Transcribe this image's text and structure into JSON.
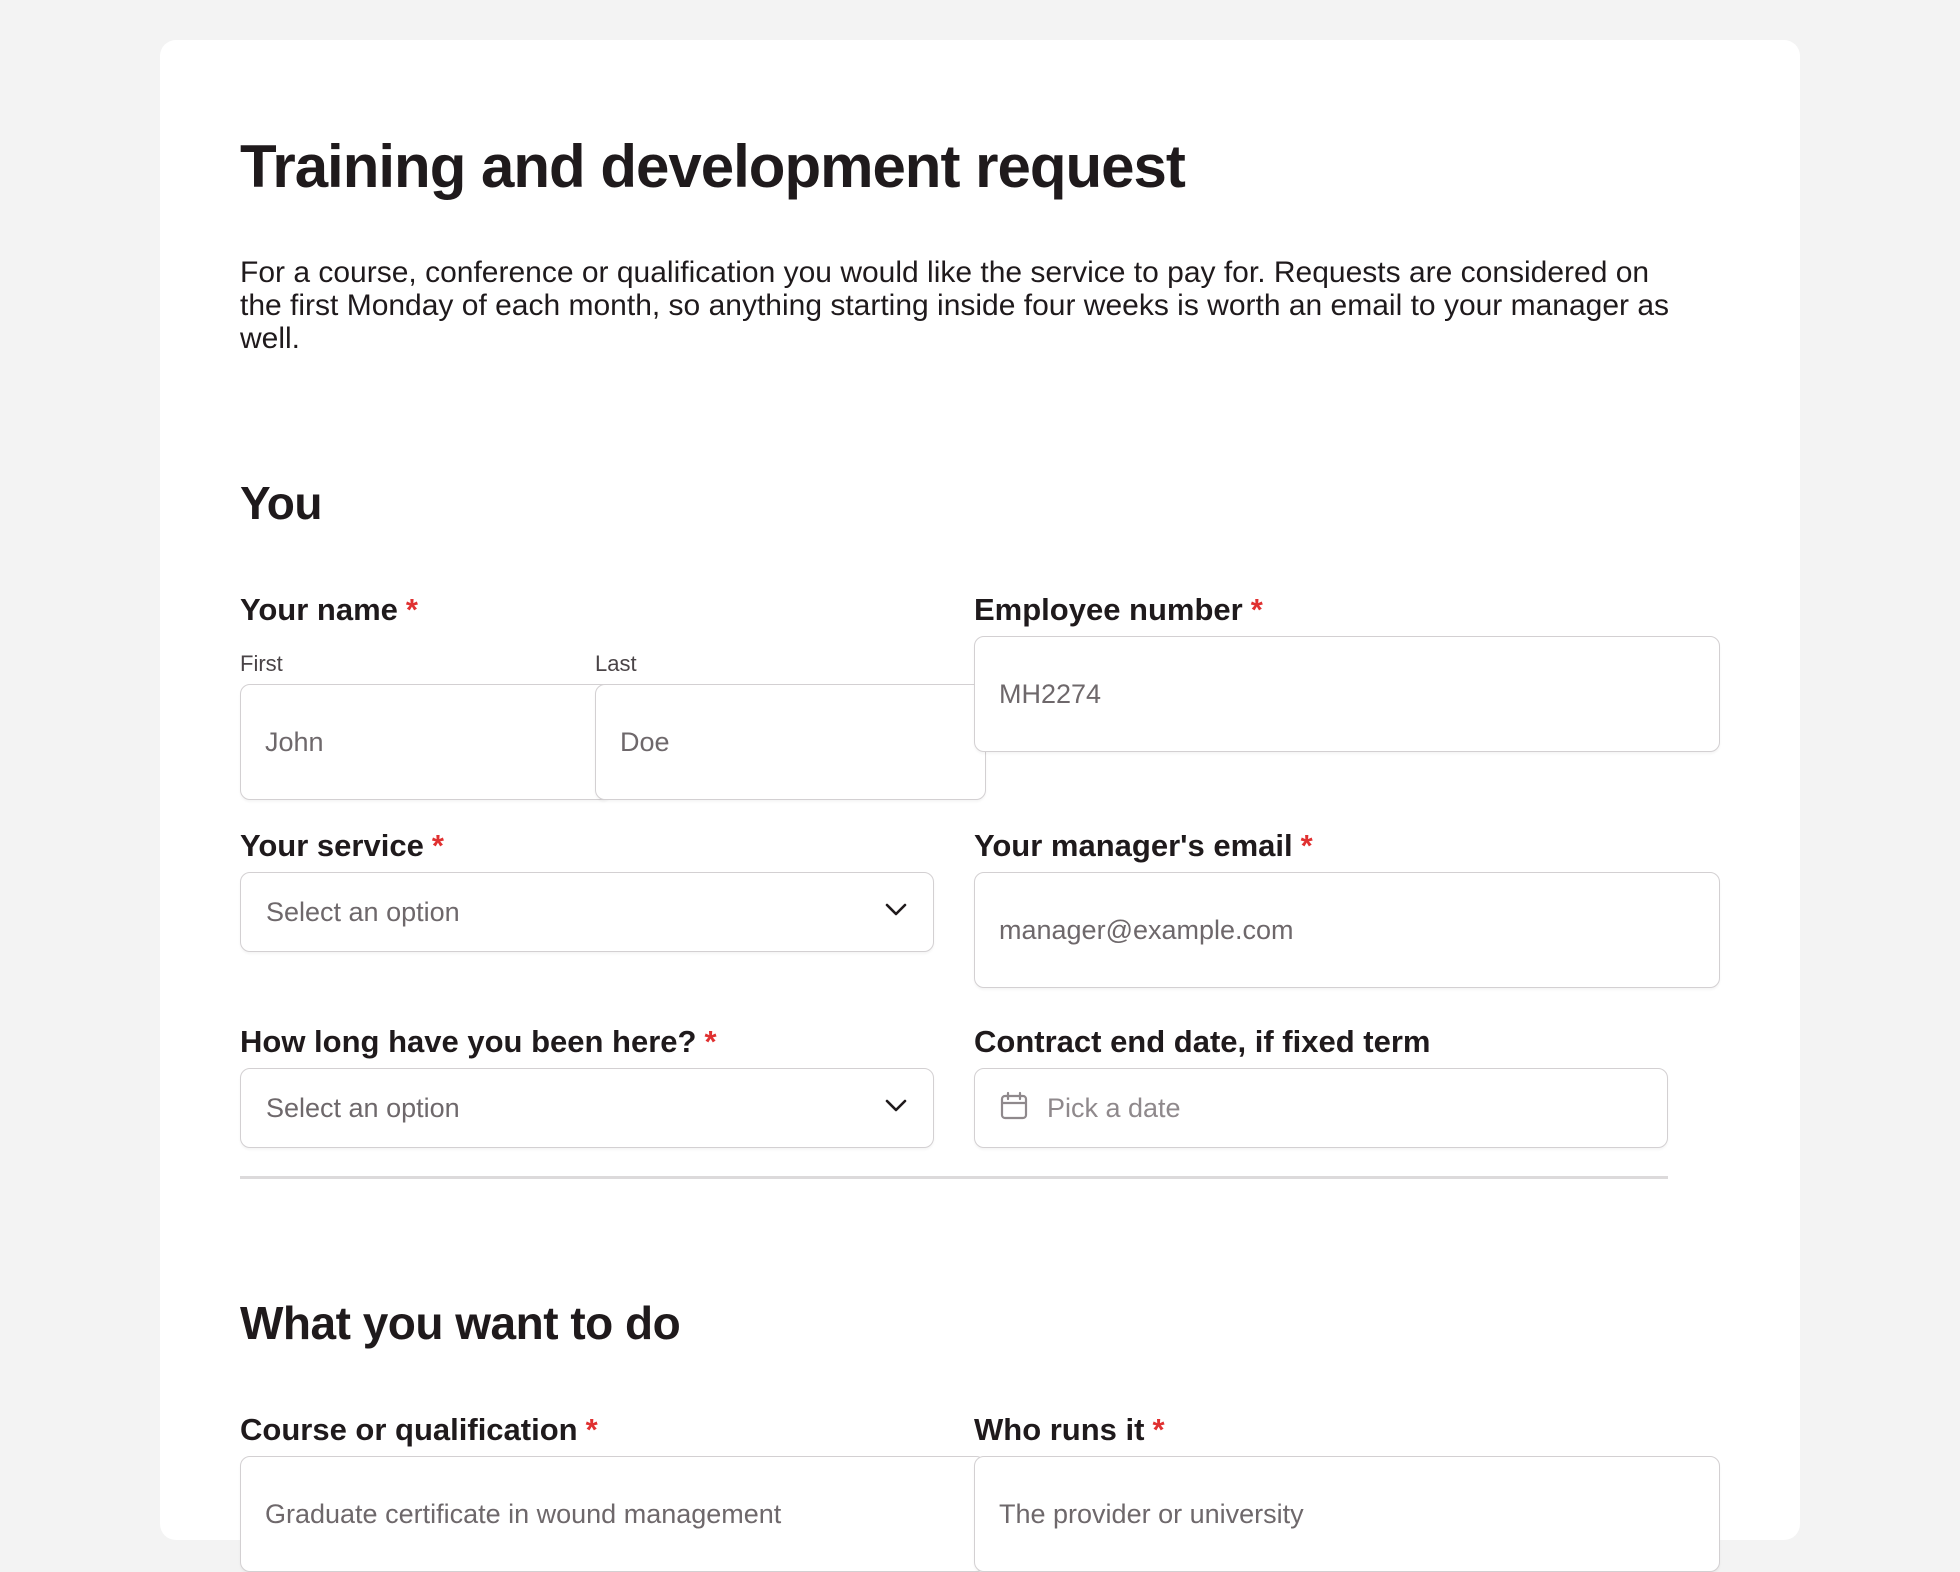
{
  "form": {
    "title": "Training and development request",
    "intro": "For a course, conference or qualification you would like the service to pay for. Requests are considered on the first Monday of each month, so anything starting inside four weeks is worth an email to your manager as well."
  },
  "section_you": {
    "heading": "You",
    "your_name": {
      "label": "Your name",
      "required_marker": "*",
      "first_label": "First",
      "first_placeholder": "John",
      "last_label": "Last",
      "last_placeholder": "Doe"
    },
    "employee_number": {
      "label": "Employee number",
      "required_marker": "*",
      "placeholder": "MH2274"
    },
    "your_service": {
      "label": "Your service",
      "required_marker": "*",
      "selected": "Select an option"
    },
    "manager_email": {
      "label": "Your manager's email",
      "required_marker": "*",
      "placeholder": "manager@example.com"
    },
    "how_long": {
      "label": "How long have you been here?",
      "required_marker": "*",
      "selected": "Select an option"
    },
    "contract_end": {
      "label": "Contract end date, if fixed term",
      "placeholder": "Pick a date"
    }
  },
  "section_what": {
    "heading": "What you want to do",
    "course": {
      "label": "Course or qualification",
      "required_marker": "*",
      "placeholder": "Graduate certificate in wound management"
    },
    "who_runs": {
      "label": "Who runs it",
      "required_marker": "*",
      "placeholder": "The provider or university"
    }
  },
  "icons": {
    "select_chevron": "chevron-down-icon",
    "date_picker": "calendar-icon"
  },
  "colors": {
    "required": "#e03131",
    "text": "#1f1a1c",
    "page_background": "#f3f3f3"
  }
}
